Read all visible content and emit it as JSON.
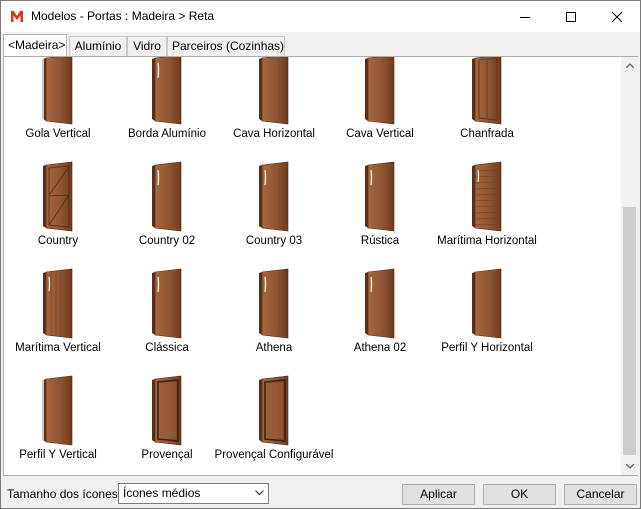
{
  "window": {
    "title": "Modelos - Portas : Madeira > Reta",
    "brand_color": "#d03a2a"
  },
  "tabs": [
    {
      "label": "<Madeira>",
      "active": true
    },
    {
      "label": "Alumínio",
      "active": false
    },
    {
      "label": "Vidro",
      "active": false
    },
    {
      "label": "Parceiros (Cozinhas)",
      "active": false
    }
  ],
  "items": [
    {
      "label": "Gola Vertical",
      "style": "gola"
    },
    {
      "label": "Borda Alumínio",
      "style": "handle"
    },
    {
      "label": "Cava Horizontal",
      "style": "plain"
    },
    {
      "label": "Cava Vertical",
      "style": "plain"
    },
    {
      "label": "Chanfrada",
      "style": "chanfrada"
    },
    {
      "label": "Country",
      "style": "country"
    },
    {
      "label": "Country 02",
      "style": "handle"
    },
    {
      "label": "Country 03",
      "style": "handle"
    },
    {
      "label": "Rústica",
      "style": "handle"
    },
    {
      "label": "Marítima Horizontal",
      "style": "hplanks"
    },
    {
      "label": "Marítima Vertical",
      "style": "vplanks"
    },
    {
      "label": "Clássica",
      "style": "handle"
    },
    {
      "label": "Athena",
      "style": "handle"
    },
    {
      "label": "Athena 02",
      "style": "handle"
    },
    {
      "label": "Perfil Y Horizontal",
      "style": "plain"
    },
    {
      "label": "Perfil Y Vertical",
      "style": "gola"
    },
    {
      "label": "Provençal",
      "style": "framed"
    },
    {
      "label": "Provençal Configurável",
      "style": "framed"
    }
  ],
  "footer": {
    "icon_size_label": "Tamanho dos ícones",
    "icon_size_value": "Ícones médios",
    "apply_label": "Aplicar",
    "ok_label": "OK",
    "cancel_label": "Cancelar"
  },
  "colors": {
    "wood_light": "#a5673f",
    "wood_dark": "#6e3b1f",
    "accent": "#0078d7"
  }
}
